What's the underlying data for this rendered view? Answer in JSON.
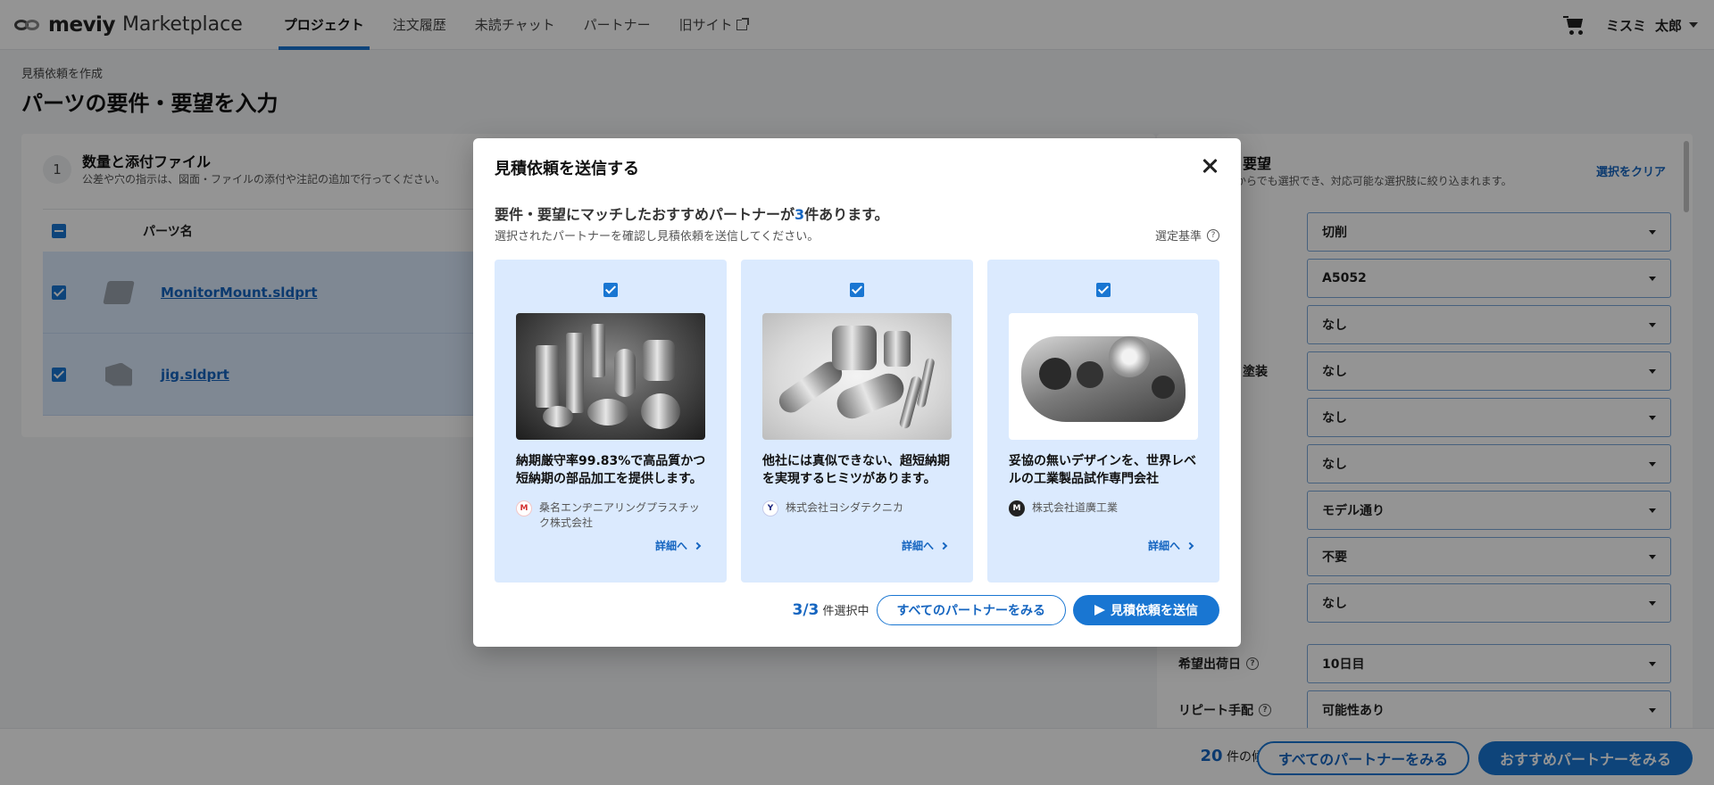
{
  "header": {
    "brand": "meviy",
    "brand_sub": "Marketplace",
    "nav": [
      "プロジェクト",
      "注文履歴",
      "未読チャット",
      "パートナー",
      "旧サイト"
    ],
    "user_company": "ミスミ",
    "user_name": "太郎"
  },
  "page": {
    "breadcrumb": "見積依頼を作成",
    "title": "パーツの要件・要望を入力"
  },
  "left": {
    "step_number": "1",
    "step_title": "数量と添付ファイル",
    "step_desc": "公差や穴の指示は、図面・ファイルの添付や注記の追加で行ってください。",
    "col_part_name": "パーツ名",
    "rows": [
      {
        "file": "MonitorMount.sldprt"
      },
      {
        "file": "jig.sldprt"
      }
    ]
  },
  "right": {
    "title": "件・要望",
    "desc": "項目からでも選択でき、対応可能な選択肢に絞り込まれます。",
    "clear": "選択をクリア",
    "label_coating": "塗装",
    "label_ship_day": "希望出荷日",
    "label_repeat": "リピート手配",
    "selects": [
      "切削",
      "A5052",
      "なし",
      "なし",
      "なし",
      "なし",
      "モデル通り",
      "不要",
      "なし",
      "10日目",
      "可能性あり"
    ]
  },
  "footer": {
    "count": "20",
    "count_suffix": "件の候補",
    "all_partners": "すべてのパートナーをみる",
    "recommended": "おすすめパートナーをみる"
  },
  "modal": {
    "title": "見積依頼を送信する",
    "lead_prefix": "要件・要望にマッチしたおすすめパートナーが",
    "lead_count": "3",
    "lead_suffix": "件あります。",
    "sub": "選択されたパートナーを確認し見積依頼を送信してください。",
    "criteria": "選定基準",
    "cards": [
      {
        "headline": "納期厳守率99.83%で高品質かつ短納期の部品加工を提供します。",
        "company": "桑名エンヂニアリングプラスチック株式会社",
        "detail": "詳細へ"
      },
      {
        "headline": "他社には真似できない、超短納期を実現するヒミツがあります。",
        "company": "株式会社ヨシダテクニカ",
        "detail": "詳細へ"
      },
      {
        "headline": "妥協の無いデザインを、世界レベルの工業製品試作専門会社",
        "company": "株式会社道廣工業",
        "detail": "詳細へ"
      }
    ],
    "selected": "3/3",
    "selected_suffix": "件選択中",
    "all_partners": "すべてのパートナーをみる",
    "send": "見積依頼を送信"
  },
  "colors": {
    "accent": "#1976d2",
    "card_bg": "#dbeafe",
    "overlay": "rgba(0,0,0,0.42)"
  },
  "icons": [
    "cart-icon",
    "external-link-icon",
    "help-icon",
    "close-icon",
    "checkbox-icon",
    "send-icon",
    "chevron-right-icon"
  ]
}
